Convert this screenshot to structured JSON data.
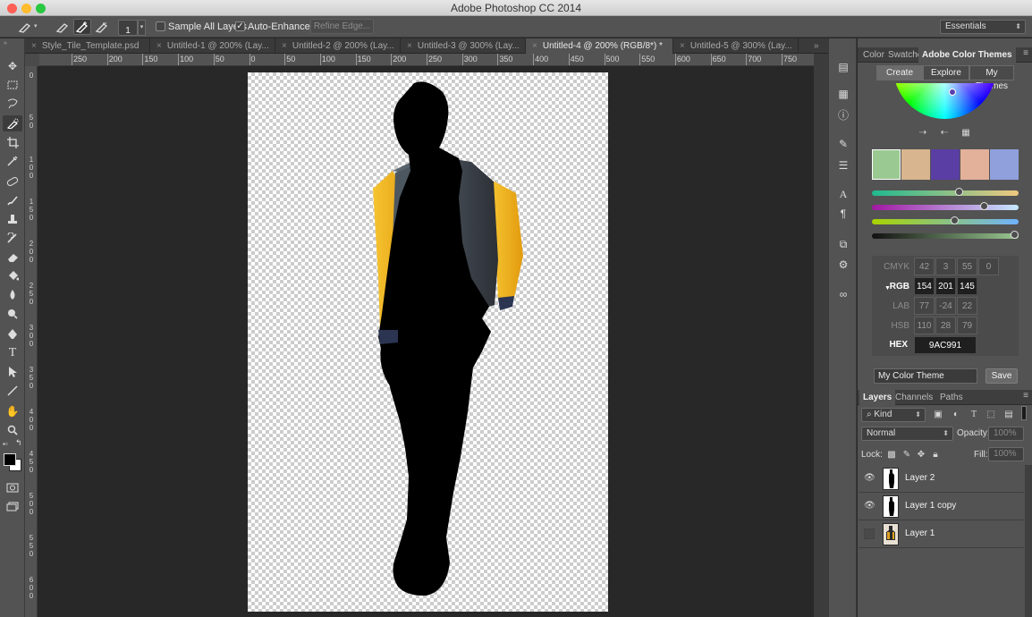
{
  "window": {
    "title": "Adobe Photoshop CC 2014",
    "traffic_lights": {
      "close": "#fe5f57",
      "minimize": "#febc2e",
      "zoom": "#28c840"
    }
  },
  "options_bar": {
    "brush_size": "1",
    "sample_all_layers_label": "Sample All Layers",
    "sample_all_layers_checked": false,
    "auto_enhance_label": "Auto-Enhance",
    "auto_enhance_checked": true,
    "refine_edge_label": "Refine Edge...",
    "workspace_label": "Essentials"
  },
  "tabs": [
    {
      "label": "Style_Tile_Template.psd",
      "active": false
    },
    {
      "label": "Untitled-1 @ 200% (Lay...",
      "active": false
    },
    {
      "label": "Untitled-2 @ 200% (Lay...",
      "active": false
    },
    {
      "label": "Untitled-3 @ 300% (Lay...",
      "active": false
    },
    {
      "label": "Untitled-4 @ 200% (RGB/8*) *",
      "active": true
    },
    {
      "label": "Untitled-5 @ 300% (Lay...",
      "active": false
    }
  ],
  "rulers": {
    "horizontal_ticks": [
      "250",
      "200",
      "150",
      "100",
      "50",
      "0",
      "50",
      "100",
      "150",
      "200",
      "250",
      "300",
      "350",
      "400",
      "450",
      "500",
      "550",
      "600",
      "650",
      "700",
      "750"
    ],
    "vertical_ticks": [
      "0",
      "50",
      "100",
      "150",
      "200",
      "250",
      "300",
      "350",
      "400",
      "450",
      "500",
      "550",
      "600"
    ]
  },
  "tools": [
    "move-tool-icon",
    "marquee-tool-icon",
    "lasso-tool-icon",
    "quick-selection-tool-icon",
    "crop-tool-icon",
    "eyedropper-tool-icon",
    "healing-brush-tool-icon",
    "brush-tool-icon",
    "clone-stamp-tool-icon",
    "history-brush-tool-icon",
    "eraser-tool-icon",
    "paint-bucket-tool-icon",
    "blur-tool-icon",
    "dodge-tool-icon",
    "pen-tool-icon",
    "type-tool-icon",
    "path-selection-tool-icon",
    "line-tool-icon",
    "hand-tool-icon",
    "zoom-tool-icon"
  ],
  "color_panel": {
    "tabs": [
      "Color",
      "Swatche",
      "Adobe Color Themes"
    ],
    "active_tab": "Adobe Color Themes",
    "modes": [
      "Create",
      "Explore",
      "My Themes"
    ],
    "active_mode": "Create",
    "swatches": [
      "#9ac991",
      "#d8b58f",
      "#5a3ea3",
      "#e3b09a",
      "#8fa0dc"
    ],
    "sliders": [
      {
        "from": "#1fb98f",
        "to": "#f0c880",
        "level": 0.6
      },
      {
        "from": "#a317a3",
        "to": "#c6e8ff",
        "level": 0.78
      },
      {
        "from": "#a8d300",
        "to": "#6fb3ff",
        "level": 0.57
      },
      {
        "from": "#111111",
        "to": "#9ac991",
        "level": 1.0
      }
    ],
    "rows": [
      {
        "label": "CMYK",
        "values": [
          "42",
          "3",
          "55",
          "0"
        ],
        "active": false
      },
      {
        "label": "RGB",
        "values": [
          "154",
          "201",
          "145"
        ],
        "active": true
      },
      {
        "label": "LAB",
        "values": [
          "77",
          "-24",
          "22"
        ],
        "active": false
      },
      {
        "label": "HSB",
        "values": [
          "110",
          "28",
          "79"
        ],
        "active": false
      }
    ],
    "hex_label": "HEX",
    "hex_value": "9AC991",
    "theme_name": "My Color Theme",
    "save_label": "Save"
  },
  "layers_panel": {
    "tabs": [
      "Layers",
      "Channels",
      "Paths"
    ],
    "active_tab": "Layers",
    "filter_label": "Kind",
    "blend_mode": "Normal",
    "opacity_label": "Opacity:",
    "opacity_value": "100%",
    "lock_label": "Lock:",
    "fill_label": "Fill:",
    "fill_value": "100%",
    "layers": [
      {
        "name": "Layer 2",
        "visible": true,
        "thumb": "silhouette"
      },
      {
        "name": "Layer 1 copy",
        "visible": true,
        "thumb": "silhouette"
      },
      {
        "name": "Layer 1",
        "visible": false,
        "thumb": "photo"
      }
    ]
  }
}
